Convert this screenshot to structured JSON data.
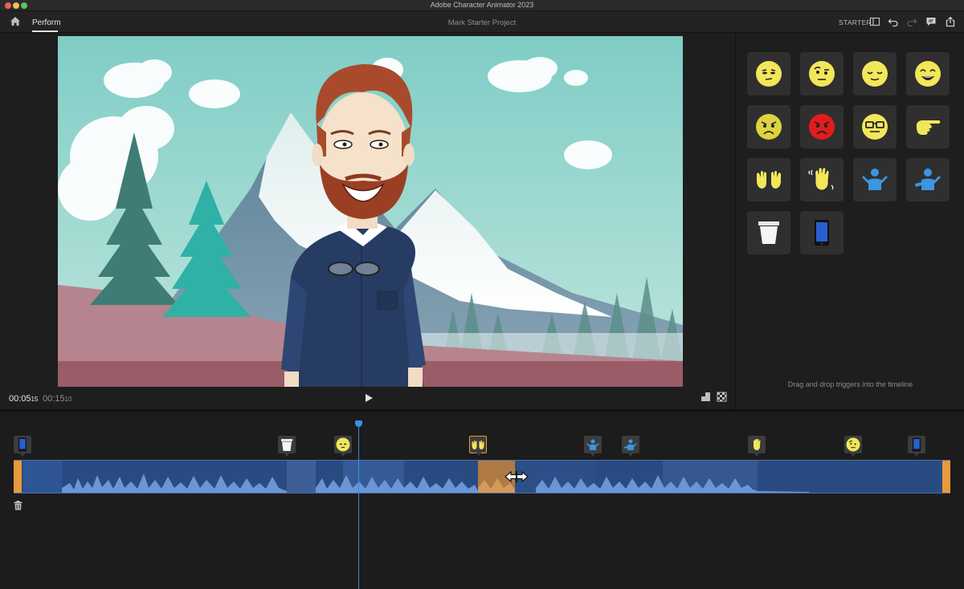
{
  "window": {
    "title": "Adobe Character Animator 2023"
  },
  "appbar": {
    "tab": "Perform",
    "project": "Mark Starter Project",
    "mode": "STARTER"
  },
  "stage": {
    "time_current": "00:05",
    "time_current_frames": "15",
    "time_total": "00:15",
    "time_total_frames": "10"
  },
  "triggers_panel": {
    "hint": "Drag and drop triggers into the timeline",
    "items": [
      "squint-face-icon",
      "raised-brow-face-icon",
      "relieved-face-icon",
      "grinning-face-icon",
      "frowning-face-icon",
      "angry-red-face-icon",
      "glasses-face-icon",
      "pointing-hand-icon",
      "two-hands-icon",
      "waving-hand-icon",
      "shrug-left-icon",
      "shrug-right-icon",
      "cup-icon",
      "phone-icon"
    ]
  },
  "timeline": {
    "markers": [
      "phone-icon",
      "cup-icon",
      "squint-face-icon",
      "two-hands-icon",
      "shrug-left-icon",
      "shrug-right-icon",
      "waving-hand-icon",
      "raised-brow-face-icon",
      "phone-icon"
    ]
  },
  "colors": {
    "accent": "#e89a3c",
    "playhead": "#3b8fe6",
    "track": "#2a4b82",
    "emoji_yellow": "#f2e65a",
    "shrug_blue": "#3b95e0"
  }
}
